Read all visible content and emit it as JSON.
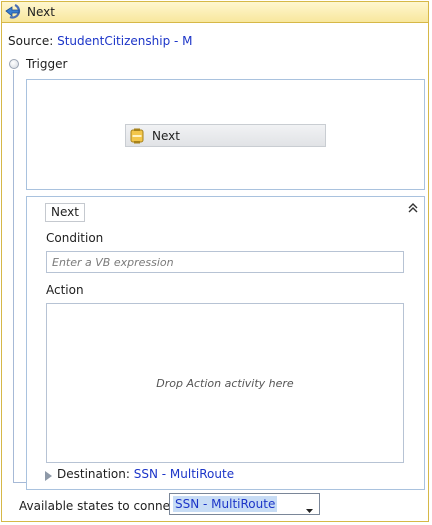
{
  "header": {
    "title": "Next",
    "icon": "back-arrow-icon"
  },
  "source": {
    "label": "Source:",
    "value": "StudentCitizenship - M"
  },
  "trigger": {
    "label": "Trigger",
    "activity": {
      "label": "Next",
      "icon": "sequence-activity-icon"
    }
  },
  "transition": {
    "name": "Next",
    "condition": {
      "label": "Condition",
      "placeholder": "Enter a VB expression",
      "value": ""
    },
    "action": {
      "label": "Action",
      "drop_hint": "Drop Action activity here"
    },
    "collapse_icon": "double-chevron-up-icon"
  },
  "destination": {
    "label": "Destination:",
    "value": "SSN - MultiRoute"
  },
  "available_states": {
    "label": "Available states to connect:",
    "selected": "SSN - MultiRoute"
  },
  "colors": {
    "link": "#1c35c8",
    "header_bg": "#f8e79d",
    "header_border": "#d6b847",
    "panel_border": "#a9c2de"
  }
}
